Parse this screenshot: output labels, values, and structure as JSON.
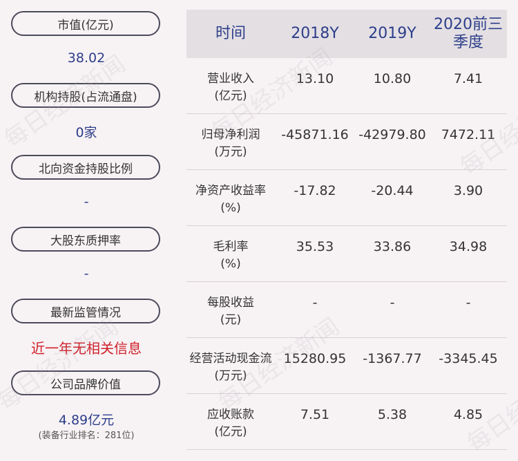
{
  "left": {
    "items": [
      {
        "label": "市值(亿元)",
        "value": "38.02"
      },
      {
        "label": "机构持股(占流通盘)",
        "value": "0家"
      },
      {
        "label": "北向资金持股比例",
        "value": "-"
      },
      {
        "label": "大股东质押率",
        "value": "-"
      },
      {
        "label": "最新监管情况",
        "value": "近一年无相关信息",
        "value_color": "#d0202a"
      },
      {
        "label": "公司品牌价值",
        "value": "4.89亿元",
        "note": "(装备行业排名：281位)"
      }
    ]
  },
  "table": {
    "headers": [
      "时间",
      "2018Y",
      "2019Y",
      "2020前三季度"
    ],
    "rows": [
      {
        "label_line1": "营业收入",
        "label_line2": "(亿元)",
        "values": [
          "13.10",
          "10.80",
          "7.41"
        ]
      },
      {
        "label_line1": "归母净利润",
        "label_line2": "(万元)",
        "values": [
          "-45871.16",
          "-42979.80",
          "7472.11"
        ]
      },
      {
        "label_line1": "净资产收益率",
        "label_line2": "(%)",
        "values": [
          "-17.82",
          "-20.44",
          "3.90"
        ]
      },
      {
        "label_line1": "毛利率",
        "label_line2": "(%)",
        "values": [
          "35.53",
          "33.86",
          "34.98"
        ]
      },
      {
        "label_line1": "每股收益",
        "label_line2": "(元)",
        "values": [
          "-",
          "-",
          "-"
        ]
      },
      {
        "label_line1": "经营活动现金流",
        "label_line2": "(万元)",
        "values": [
          "15280.95",
          "-1367.77",
          "-3345.45"
        ]
      },
      {
        "label_line1": "应收账款",
        "label_line2": "(亿元)",
        "values": [
          "7.51",
          "5.38",
          "4.85"
        ]
      }
    ]
  },
  "watermark": "每日经济新闻",
  "colors": {
    "background": "#f7f2f4",
    "header_bg": "#e3dfe3",
    "accent_blue": "#2d3e8a",
    "alert_red": "#d0202a"
  }
}
